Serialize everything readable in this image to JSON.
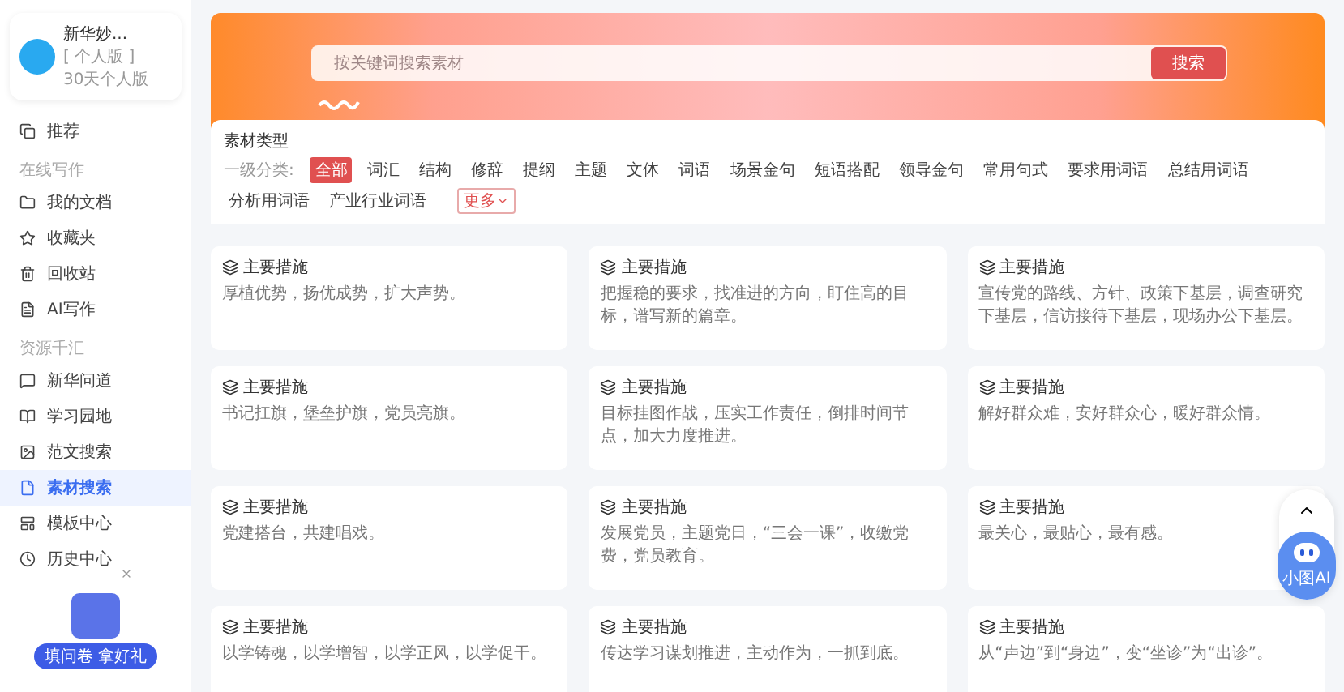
{
  "user": {
    "name": "新华妙...",
    "edition": "[ 个人版 ]",
    "plan": "30天个人版"
  },
  "sidebar": {
    "items": [
      {
        "kind": "item",
        "label": "推荐",
        "selected": false
      },
      {
        "kind": "section",
        "label": "在线写作"
      },
      {
        "kind": "item",
        "label": "我的文档",
        "selected": false
      },
      {
        "kind": "item",
        "label": "收藏夹",
        "selected": false
      },
      {
        "kind": "item",
        "label": "回收站",
        "selected": false
      },
      {
        "kind": "item",
        "label": "AI写作",
        "selected": false
      },
      {
        "kind": "section",
        "label": "资源千汇"
      },
      {
        "kind": "item",
        "label": "新华问道",
        "selected": false
      },
      {
        "kind": "item",
        "label": "学习园地",
        "selected": false
      },
      {
        "kind": "item",
        "label": "范文搜索",
        "selected": false
      },
      {
        "kind": "item",
        "label": "素材搜索",
        "selected": true
      },
      {
        "kind": "item",
        "label": "模板中心",
        "selected": false
      },
      {
        "kind": "item",
        "label": "历史中心",
        "selected": false
      }
    ]
  },
  "promo": {
    "label": "填问卷 拿好礼"
  },
  "search": {
    "placeholder": "按关键词搜索素材",
    "button": "搜索"
  },
  "filter": {
    "title": "素材类型",
    "label": "一级分类:",
    "more": "更多",
    "categories": [
      {
        "label": "全部",
        "selected": true
      },
      {
        "label": "词汇",
        "selected": false
      },
      {
        "label": "结构",
        "selected": false
      },
      {
        "label": "修辞",
        "selected": false
      },
      {
        "label": "提纲",
        "selected": false
      },
      {
        "label": "主题",
        "selected": false
      },
      {
        "label": "文体",
        "selected": false
      },
      {
        "label": "词语",
        "selected": false
      },
      {
        "label": "场景金句",
        "selected": false
      },
      {
        "label": "短语搭配",
        "selected": false
      },
      {
        "label": "领导金句",
        "selected": false
      },
      {
        "label": "常用句式",
        "selected": false
      },
      {
        "label": "要求用词语",
        "selected": false
      },
      {
        "label": "总结用词语",
        "selected": false
      },
      {
        "label": "分析用词语",
        "selected": false
      },
      {
        "label": "产业行业词语",
        "selected": false
      }
    ]
  },
  "cards": [
    {
      "title": "主要措施",
      "text": "厚植优势，扬优成势，扩大声势。"
    },
    {
      "title": "主要措施",
      "text": "把握稳的要求，找准进的方向，盯住高的目标，谱写新的篇章。"
    },
    {
      "title": "主要措施",
      "text": "宣传党的路线、方针、政策下基层，调查研究下基层，信访接待下基层，现场办公下基层。"
    },
    {
      "title": "主要措施",
      "text": "书记扛旗，堡垒护旗，党员亮旗。"
    },
    {
      "title": "主要措施",
      "text": "目标挂图作战，压实工作责任，倒排时间节点，加大力度推进。"
    },
    {
      "title": "主要措施",
      "text": "解好群众难，安好群众心，暖好群众情。"
    },
    {
      "title": "主要措施",
      "text": "党建搭台，共建唱戏。"
    },
    {
      "title": "主要措施",
      "text": "发展党员，主题党日，“三会一课”，收缴党费，党员教育。"
    },
    {
      "title": "主要措施",
      "text": "最关心，最贴心，最有感。"
    },
    {
      "title": "主要措施",
      "text": "以学铸魂，以学增智，以学正风，以学促干。"
    },
    {
      "title": "主要措施",
      "text": "传达学习谋划推进，主动作为，一抓到底。"
    },
    {
      "title": "主要措施",
      "text": "从“声边”到“身边”，变“坐诊”为“出诊”。"
    }
  ],
  "assistant": {
    "label": "小图AI"
  }
}
